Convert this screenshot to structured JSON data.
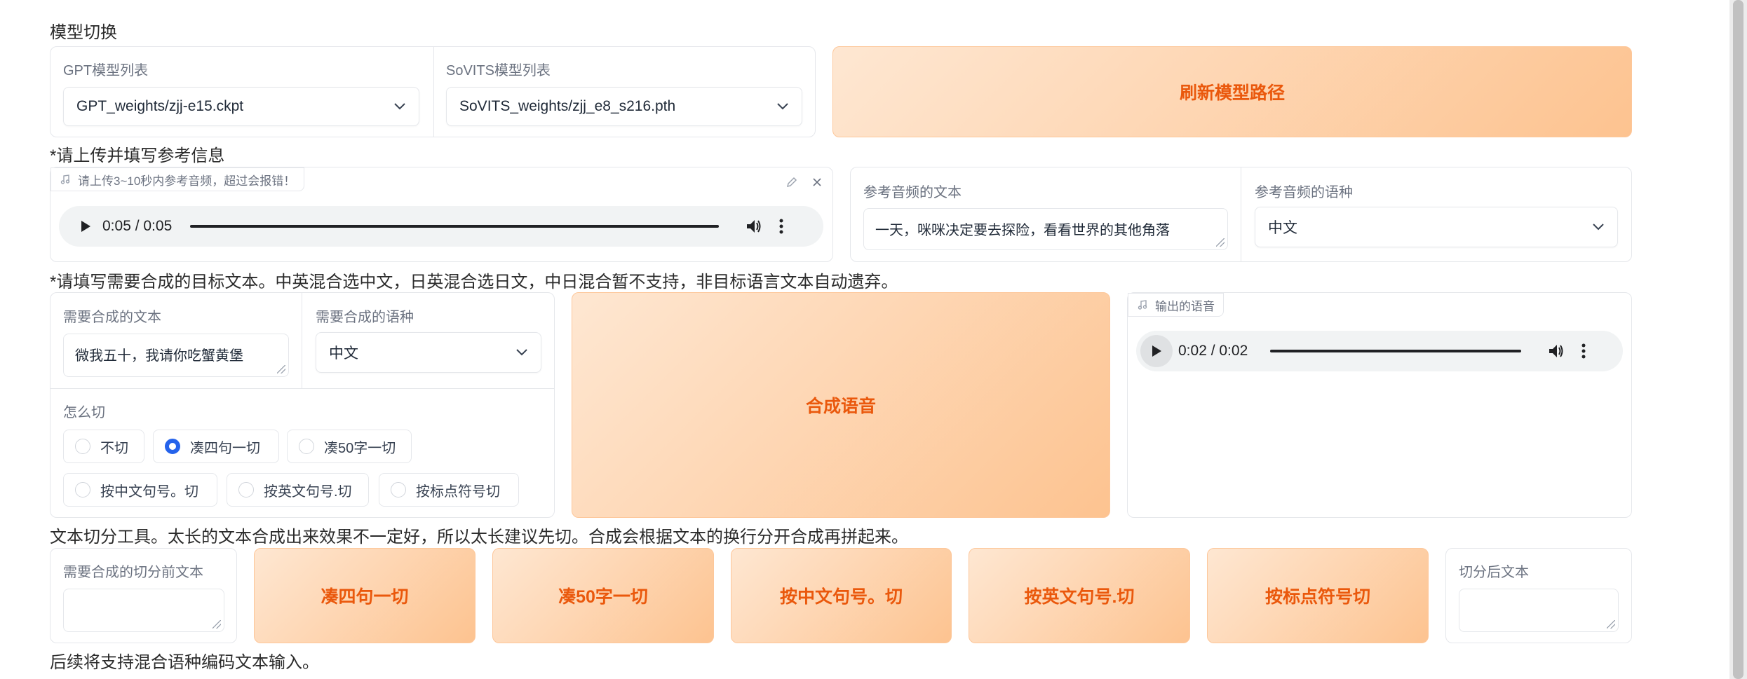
{
  "model": {
    "heading": "模型切换",
    "gpt": {
      "label": "GPT模型列表",
      "value": "GPT_weights/zjj-e15.ckpt"
    },
    "sovits": {
      "label": "SoVITS模型列表",
      "value": "SoVITS_weights/zjj_e8_s216.pth"
    },
    "refresh_label": "刷新模型路径"
  },
  "reference": {
    "heading": "*请上传并填写参考信息",
    "audio_tag": "请上传3~10秒内参考音频，超过会报错！",
    "audio_time": "0:05 / 0:05",
    "text_label": "参考音频的文本",
    "text_value": "一天，咪咪决定要去探险，看看世界的其他角落",
    "lang_label": "参考音频的语种",
    "lang_value": "中文"
  },
  "target": {
    "heading": "*请填写需要合成的目标文本。中英混合选中文，日英混合选日文，中日混合暂不支持，非目标语言文本自动遗弃。",
    "text_label": "需要合成的文本",
    "text_value": "微我五十，我请你吃蟹黄堡",
    "lang_label": "需要合成的语种",
    "lang_value": "中文",
    "cut_label": "怎么切",
    "cut_options": [
      "不切",
      "凑四句一切",
      "凑50字一切",
      "按中文句号。切",
      "按英文句号.切",
      "按标点符号切"
    ],
    "cut_selected": "凑四句一切",
    "synth_label": "合成语音",
    "output_tag": "输出的语音",
    "output_time": "0:02 / 0:02"
  },
  "splitter": {
    "heading": "文本切分工具。太长的文本合成出来效果不一定好，所以太长建议先切。合成会根据文本的换行分开合成再拼起来。",
    "input_label": "需要合成的切分前文本",
    "input_value": "",
    "buttons": [
      "凑四句一切",
      "凑50字一切",
      "按中文句号。切",
      "按英文句号.切",
      "按标点符号切"
    ],
    "output_label": "切分后文本",
    "output_value": ""
  },
  "footer": "后续将支持混合语种编码文本输入。",
  "colors": {
    "accent": "#ea580c",
    "radio": "#2563eb",
    "scroll_track": "#ececec",
    "scroll_thumb": "#c1c1c1"
  }
}
